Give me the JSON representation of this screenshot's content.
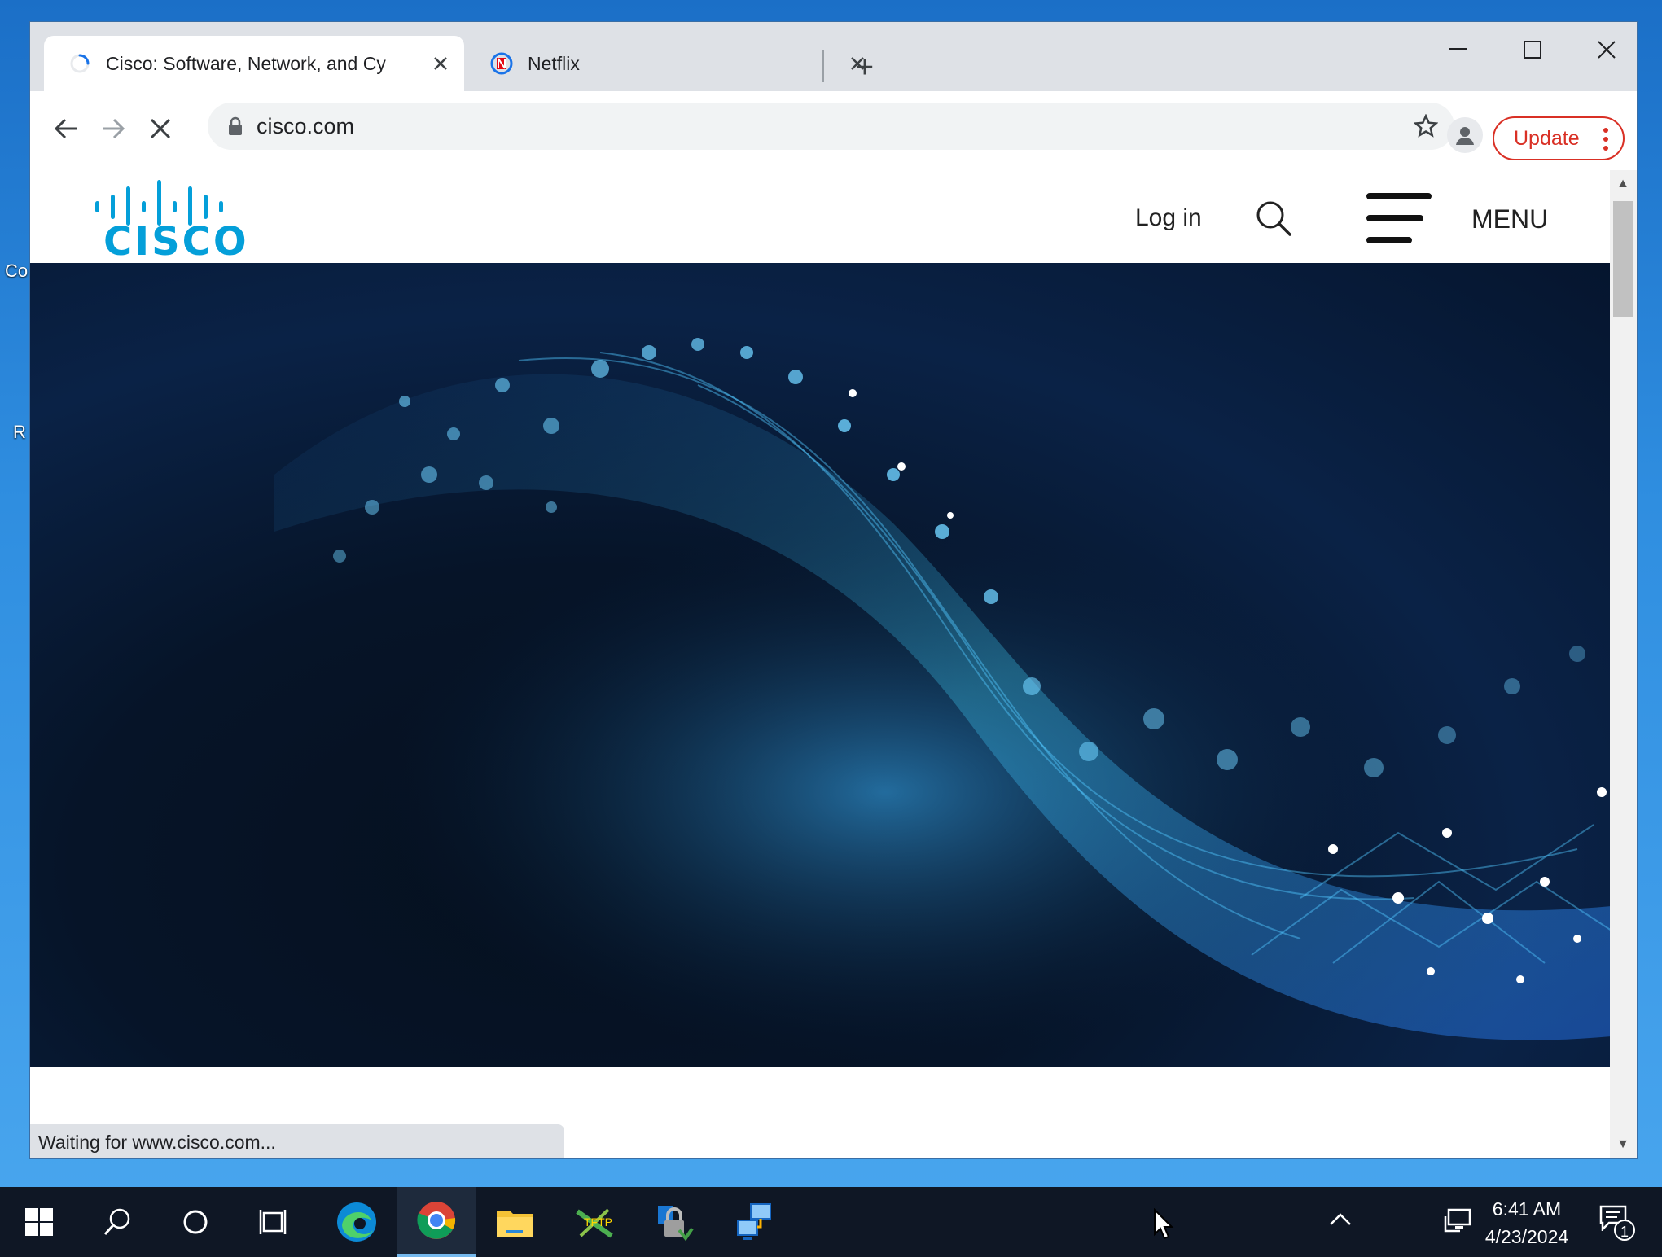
{
  "desktop": {
    "icon_labels": [
      "Co",
      "R"
    ]
  },
  "browser": {
    "tabs": [
      {
        "title": "Cisco: Software, Network, and Cy",
        "active": true
      },
      {
        "title": "Netflix",
        "active": false
      }
    ],
    "new_tab_symbol": "+",
    "address": "cisco.com",
    "update_label": "Update",
    "status_text": "Waiting for www.cisco.com..."
  },
  "page": {
    "logo_text": "CISCO",
    "nav": {
      "login": "Log in",
      "menu": "MENU"
    }
  },
  "taskbar": {
    "apps": [
      "start-icon",
      "search-icon",
      "cortana-icon",
      "task-view-icon",
      "edge-icon",
      "chrome-icon",
      "file-explorer-icon",
      "network-tool-icon",
      "vpn-lock-icon",
      "remote-network-icon"
    ],
    "active_app": "chrome-icon",
    "time": "6:41 AM",
    "date": "4/23/2024",
    "notification_count": "1"
  },
  "colors": {
    "cisco_blue": "#049fd9",
    "update_red": "#d93025",
    "taskbar": "#0f1725"
  }
}
